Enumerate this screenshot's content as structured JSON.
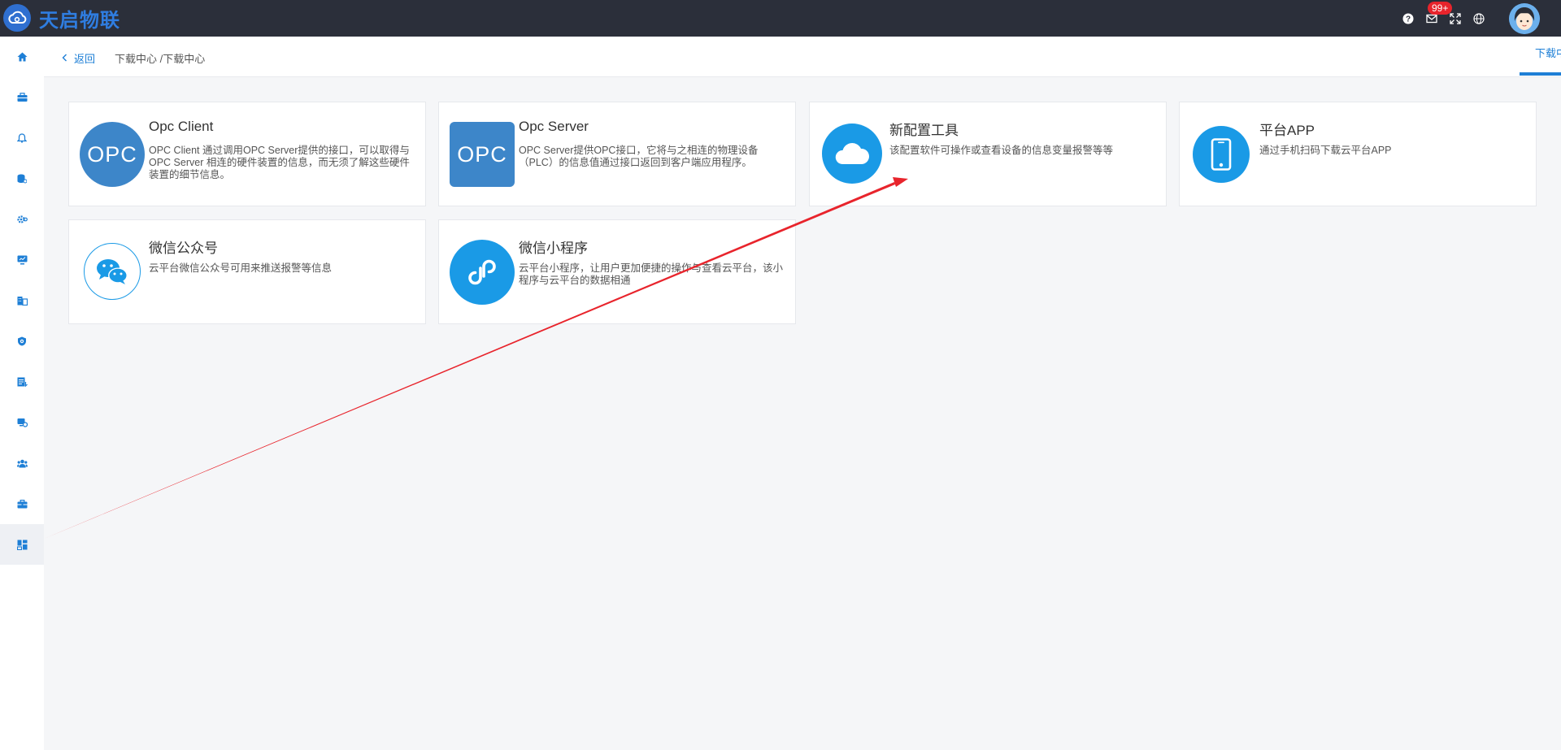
{
  "header": {
    "brand": "天启物联",
    "notification_count": "99+",
    "icons": [
      "help-icon",
      "mail-icon",
      "fullscreen-icon",
      "globe-icon",
      "avatar"
    ]
  },
  "sidebar": {
    "items": [
      "home-icon",
      "toolbox-icon",
      "bell-icon",
      "database-icon",
      "settings-icon",
      "monitor-icon",
      "building-icon",
      "shield-icon",
      "report-icon",
      "device-settings-icon",
      "users-icon",
      "briefcase-icon",
      "dashboard-icon"
    ],
    "active_index": 12
  },
  "breadcrumb": {
    "back_label": "返回",
    "path": "下载中心 /下载中心",
    "active_tab": "下载中心"
  },
  "cards": [
    {
      "title": "Opc Client",
      "desc": "OPC Client 通过调用OPC Server提供的接口，可以取得与 OPC Server 相连的硬件装置的信息，而无须了解这些硬件装置的细节信息。",
      "icon": "opc-client-icon",
      "icon_text": "OPC"
    },
    {
      "title": "Opc Server",
      "desc": "OPC Server提供OPC接口，它将与之相连的物理设备（PLC）的信息值通过接口返回到客户端应用程序。",
      "icon": "opc-server-icon",
      "icon_text": "OPC"
    },
    {
      "title": "新配置工具",
      "desc": "该配置软件可操作或查看设备的信息变量报警等等",
      "icon": "cloud-icon"
    },
    {
      "title": "平台APP",
      "desc": "通过手机扫码下载云平台APP",
      "icon": "phone-icon"
    },
    {
      "title": "微信公众号",
      "desc": "云平台微信公众号可用来推送报警等信息",
      "icon": "wechat-icon"
    },
    {
      "title": "微信小程序",
      "desc": "云平台小程序，让用户更加便捷的操作与查看云平台，该小程序与云平台的数据相通",
      "icon": "mini-program-icon"
    }
  ],
  "colors": {
    "topbar": "#2b2f3a",
    "accent": "#1e7fd6",
    "icon_blue": "#1a9ae6",
    "opc_blue": "#3d86c9",
    "arrow": "#e8242c"
  }
}
